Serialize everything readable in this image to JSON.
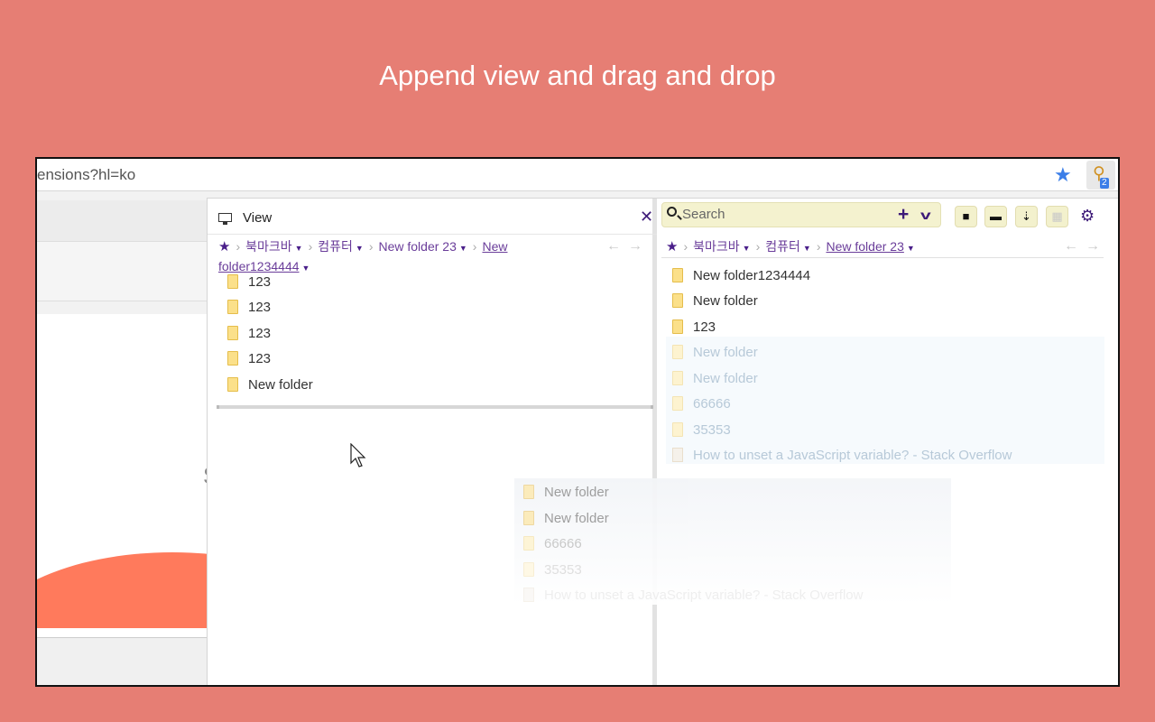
{
  "headline": "Append view and drag and drop",
  "browser": {
    "url": "ensions?hl=ko",
    "extension_badge": "2"
  },
  "view_pane": {
    "title": "View",
    "breadcrumbs": [
      "북마크바",
      "컴퓨터",
      "New folder 23",
      "New folder1234444"
    ],
    "items": [
      "123",
      "123",
      "123",
      "123",
      "New folder"
    ]
  },
  "drag_ghost": {
    "items": [
      "New folder",
      "New folder",
      "66666",
      "35353",
      "How to unset a JavaScript variable? - Stack Overflow"
    ]
  },
  "main_pane": {
    "search_placeholder": "Search",
    "breadcrumbs": [
      "북마크바",
      "컴퓨터",
      "New folder 23"
    ],
    "items": [
      "New folder1234444",
      "New folder",
      "123"
    ],
    "dragging_items": [
      "New folder",
      "New folder",
      "66666",
      "35353",
      "How to unset a JavaScript variable? - Stack Overflow"
    ]
  },
  "colors": {
    "background": "#e67e74",
    "accent": "#3d1a78",
    "link": "#6a3d9a",
    "search_bg": "#f4f2cf",
    "star": "#3b7ee8"
  }
}
